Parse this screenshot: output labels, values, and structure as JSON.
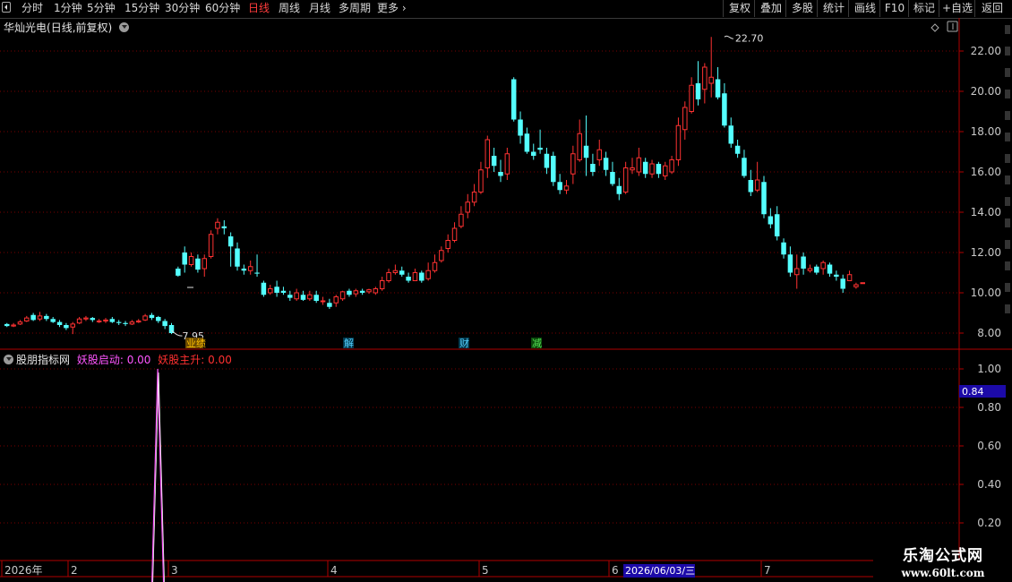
{
  "toolbar": {
    "left_items": [
      "分时",
      "1分钟",
      "5分钟",
      "15分钟",
      "30分钟",
      "60分钟",
      "日线",
      "周线",
      "月线",
      "多周期",
      "更多"
    ],
    "active": "日线",
    "right_buttons": [
      "复权",
      "叠加",
      "多股",
      "统计",
      "画线",
      "F10",
      "标记",
      "+自选",
      "返回"
    ]
  },
  "main": {
    "stock_name": "华灿光电",
    "period_info": "(日线,前复权)",
    "max_label": "22.70",
    "min_label": "7.95"
  },
  "y_axis_main": [
    "22.00",
    "20.00",
    "18.00",
    "16.00",
    "14.00",
    "12.00",
    "10.00",
    "8.00"
  ],
  "event_markers": [
    {
      "text": "业绩",
      "color": "#ffc000",
      "bg": "#6b4a00"
    },
    {
      "text": "解",
      "color": "#55d0ff",
      "bg": "#00394e"
    },
    {
      "text": "财",
      "color": "#55d0ff",
      "bg": "#00394e"
    },
    {
      "text": "减",
      "color": "#55e055",
      "bg": "#0b4a0b"
    }
  ],
  "sub": {
    "indicator_name": "股朋指标网",
    "signal1_label": "妖股启动:",
    "signal1_value": "0.00",
    "signal2_label": "妖股主升:",
    "signal2_value": "0.00",
    "signal1_color": "#ff55ff",
    "signal2_color": "#ff3030",
    "cursor_value": "0.84"
  },
  "y_axis_sub": [
    "1.00",
    "0.80",
    "0.60",
    "0.40",
    "0.20"
  ],
  "x_axis": {
    "labels": [
      "2026年",
      "2",
      "3",
      "4",
      "5",
      "6",
      "7"
    ],
    "cursor_date": "2026/06/03/三"
  },
  "watermark": {
    "line1": "乐淘公式网",
    "line2": "www.60lt.com"
  },
  "colors": {
    "up": "#ff3232",
    "down": "#54ffff",
    "grid": "#7a0000",
    "axis": "#b00000",
    "bg": "#000000"
  },
  "chart_data": {
    "type": "candlestick",
    "ylim": [
      7.4,
      23.3
    ],
    "fields": [
      "open",
      "close",
      "high",
      "low"
    ],
    "candles": [
      [
        8.45,
        8.35,
        8.5,
        8.3
      ],
      [
        8.35,
        8.4,
        8.5,
        8.3
      ],
      [
        8.45,
        8.55,
        8.65,
        8.4
      ],
      [
        8.6,
        8.75,
        8.85,
        8.55
      ],
      [
        8.9,
        8.65,
        9.0,
        8.6
      ],
      [
        8.7,
        8.85,
        9.05,
        8.6
      ],
      [
        8.85,
        8.7,
        8.95,
        8.6
      ],
      [
        8.7,
        8.55,
        8.8,
        8.5
      ],
      [
        8.55,
        8.4,
        8.65,
        8.3
      ],
      [
        8.4,
        8.25,
        8.5,
        8.15
      ],
      [
        8.3,
        8.45,
        8.55,
        7.95
      ],
      [
        8.5,
        8.7,
        8.8,
        8.45
      ],
      [
        8.7,
        8.75,
        8.85,
        8.6
      ],
      [
        8.75,
        8.65,
        8.8,
        8.55
      ],
      [
        8.6,
        8.6,
        8.7,
        8.5
      ],
      [
        8.6,
        8.65,
        8.75,
        8.5
      ],
      [
        8.7,
        8.55,
        8.8,
        8.5
      ],
      [
        8.55,
        8.5,
        8.65,
        8.4
      ],
      [
        8.5,
        8.45,
        8.6,
        8.35
      ],
      [
        8.45,
        8.55,
        8.65,
        8.4
      ],
      [
        8.55,
        8.6,
        8.7,
        8.5
      ],
      [
        8.65,
        8.85,
        8.95,
        8.6
      ],
      [
        8.9,
        8.75,
        9.0,
        8.65
      ],
      [
        8.8,
        8.6,
        8.85,
        8.5
      ],
      [
        8.6,
        8.35,
        8.7,
        8.2
      ],
      [
        8.4,
        8.0,
        8.5,
        7.95
      ],
      [
        11.2,
        10.85,
        11.3,
        10.8
      ],
      [
        12.0,
        11.4,
        12.3,
        11.0
      ],
      [
        11.4,
        11.8,
        12.0,
        11.3
      ],
      [
        11.7,
        11.15,
        11.9,
        11.0
      ],
      [
        11.2,
        11.7,
        11.9,
        10.8
      ],
      [
        11.8,
        12.9,
        13.1,
        11.7
      ],
      [
        13.2,
        13.5,
        13.7,
        12.9
      ],
      [
        13.3,
        13.2,
        13.6,
        12.9
      ],
      [
        12.8,
        12.3,
        13.0,
        11.3
      ],
      [
        12.2,
        11.3,
        12.5,
        11.1
      ],
      [
        11.2,
        11.1,
        11.4,
        10.9
      ],
      [
        11.1,
        11.3,
        11.6,
        10.9
      ],
      [
        11.0,
        10.95,
        11.9,
        10.8
      ],
      [
        10.5,
        9.9,
        10.6,
        9.8
      ],
      [
        10.0,
        10.2,
        10.4,
        9.9
      ],
      [
        10.3,
        10.0,
        10.6,
        9.8
      ],
      [
        10.1,
        10.0,
        10.3,
        9.9
      ],
      [
        9.9,
        9.75,
        10.1,
        9.6
      ],
      [
        9.7,
        10.0,
        10.2,
        9.6
      ],
      [
        9.9,
        9.65,
        10.1,
        9.6
      ],
      [
        9.7,
        9.9,
        10.1,
        9.6
      ],
      [
        9.9,
        9.6,
        10.1,
        9.5
      ],
      [
        9.6,
        9.6,
        9.8,
        9.4
      ],
      [
        9.5,
        9.3,
        9.7,
        9.2
      ],
      [
        9.5,
        9.8,
        9.9,
        9.3
      ],
      [
        9.7,
        10.05,
        10.1,
        9.6
      ],
      [
        10.1,
        9.9,
        10.2,
        9.8
      ],
      [
        9.95,
        10.1,
        10.2,
        9.8
      ],
      [
        10.1,
        10.0,
        10.2,
        9.9
      ],
      [
        10.05,
        10.15,
        10.2,
        9.95
      ],
      [
        10.0,
        10.2,
        10.3,
        9.9
      ],
      [
        10.2,
        10.6,
        10.8,
        10.1
      ],
      [
        10.6,
        11.0,
        11.2,
        10.5
      ],
      [
        11.0,
        11.1,
        11.4,
        10.9
      ],
      [
        11.1,
        10.9,
        11.3,
        10.8
      ],
      [
        10.8,
        10.6,
        11.0,
        10.5
      ],
      [
        10.6,
        11.0,
        11.2,
        10.6
      ],
      [
        11.0,
        10.6,
        11.1,
        10.5
      ],
      [
        10.7,
        11.1,
        11.5,
        10.6
      ],
      [
        11.1,
        11.5,
        11.9,
        11.0
      ],
      [
        11.6,
        12.1,
        12.3,
        11.5
      ],
      [
        12.2,
        12.6,
        12.9,
        12.0
      ],
      [
        12.6,
        13.2,
        13.5,
        12.5
      ],
      [
        13.3,
        13.9,
        14.3,
        13.2
      ],
      [
        14.0,
        14.5,
        14.9,
        13.7
      ],
      [
        14.5,
        15.0,
        15.4,
        14.3
      ],
      [
        15.0,
        16.1,
        16.5,
        14.9
      ],
      [
        16.2,
        17.6,
        17.8,
        15.7
      ],
      [
        16.8,
        16.3,
        17.2,
        16.0
      ],
      [
        16.0,
        15.8,
        16.6,
        15.5
      ],
      [
        15.9,
        16.9,
        17.2,
        15.6
      ],
      [
        20.6,
        18.6,
        20.7,
        18.5
      ],
      [
        18.6,
        17.8,
        19.0,
        17.4
      ],
      [
        17.9,
        17.0,
        18.2,
        16.9
      ],
      [
        17.0,
        16.8,
        17.4,
        16.6
      ],
      [
        17.2,
        17.1,
        18.1,
        16.9
      ],
      [
        16.9,
        16.2,
        17.2,
        15.9
      ],
      [
        16.8,
        15.5,
        17.0,
        15.3
      ],
      [
        15.5,
        15.1,
        15.9,
        14.9
      ],
      [
        15.1,
        15.3,
        15.6,
        14.9
      ],
      [
        15.9,
        16.9,
        17.3,
        15.4
      ],
      [
        16.6,
        17.9,
        18.6,
        16.5
      ],
      [
        17.3,
        16.7,
        18.8,
        15.8
      ],
      [
        16.4,
        16.0,
        16.9,
        15.8
      ],
      [
        16.6,
        17.1,
        17.6,
        16.3
      ],
      [
        16.7,
        16.1,
        17.0,
        15.8
      ],
      [
        16.0,
        15.4,
        16.5,
        15.3
      ],
      [
        15.3,
        14.9,
        15.7,
        14.6
      ],
      [
        15.0,
        16.2,
        16.5,
        14.9
      ],
      [
        16.1,
        16.2,
        16.7,
        15.9
      ],
      [
        16.0,
        16.7,
        17.2,
        15.8
      ],
      [
        16.5,
        15.9,
        16.7,
        15.7
      ],
      [
        15.9,
        16.4,
        16.6,
        15.7
      ],
      [
        16.4,
        15.9,
        16.5,
        15.7
      ],
      [
        15.8,
        16.3,
        16.5,
        15.6
      ],
      [
        16.0,
        16.6,
        16.8,
        15.9
      ],
      [
        16.6,
        18.3,
        18.7,
        16.3
      ],
      [
        18.1,
        19.2,
        19.5,
        17.6
      ],
      [
        19.0,
        20.3,
        20.7,
        18.9
      ],
      [
        20.4,
        19.6,
        21.5,
        19.3
      ],
      [
        20.1,
        21.2,
        21.4,
        19.4
      ],
      [
        20.4,
        20.7,
        22.7,
        19.7
      ],
      [
        20.6,
        19.7,
        21.2,
        19.6
      ],
      [
        19.9,
        18.3,
        20.4,
        18.2
      ],
      [
        18.3,
        17.4,
        18.7,
        17.2
      ],
      [
        17.3,
        16.9,
        17.6,
        16.7
      ],
      [
        16.7,
        15.8,
        17.1,
        15.7
      ],
      [
        15.6,
        15.0,
        16.1,
        14.8
      ],
      [
        15.1,
        15.6,
        16.5,
        15.0
      ],
      [
        15.5,
        13.9,
        15.8,
        13.7
      ],
      [
        13.8,
        13.4,
        14.2,
        13.2
      ],
      [
        13.9,
        12.8,
        14.3,
        12.6
      ],
      [
        12.5,
        11.9,
        12.7,
        11.7
      ],
      [
        11.9,
        11.0,
        12.3,
        10.8
      ],
      [
        10.9,
        11.2,
        11.9,
        10.2
      ],
      [
        11.8,
        11.2,
        12.0,
        10.9
      ],
      [
        11.1,
        11.2,
        11.4,
        11.0
      ],
      [
        11.3,
        11.0,
        11.4,
        10.9
      ],
      [
        11.2,
        11.5,
        11.6,
        10.9
      ],
      [
        11.4,
        10.95,
        11.5,
        10.8
      ],
      [
        10.9,
        10.8,
        11.1,
        10.6
      ],
      [
        10.7,
        10.2,
        10.9,
        10.0
      ],
      [
        10.6,
        10.9,
        11.1,
        10.6
      ],
      [
        10.3,
        10.4,
        10.5,
        10.2
      ],
      [
        10.5,
        10.5,
        10.5,
        10.5
      ]
    ],
    "marker_label_hi": "22.70",
    "marker_label_lo": "7.95",
    "sub_series": {
      "name_up": "妖股启动",
      "name_main": "妖股主升",
      "spike_index": 26,
      "spike_value": 1.0,
      "ylim": [
        0,
        1.1
      ]
    }
  }
}
